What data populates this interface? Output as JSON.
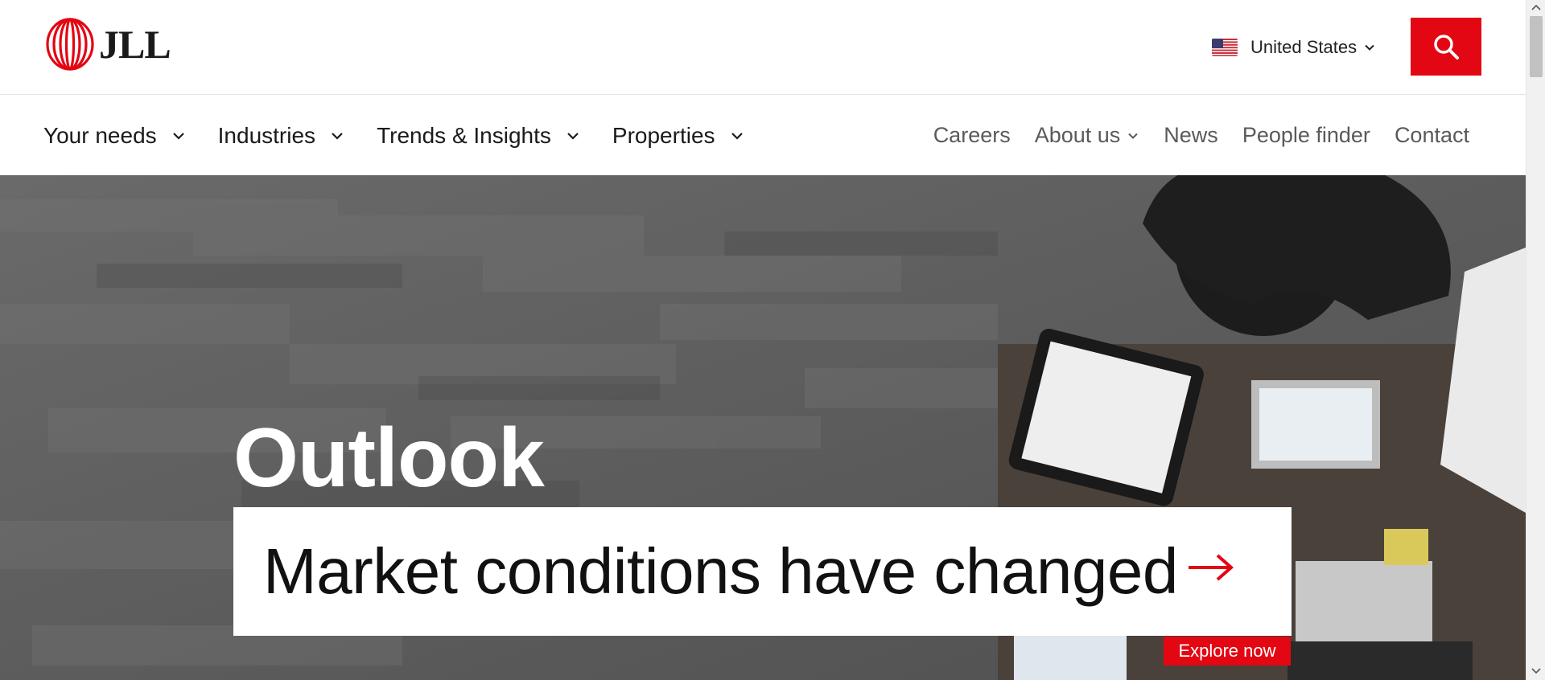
{
  "brand": {
    "logo_text": "JLL",
    "accent_color": "#e30613"
  },
  "header": {
    "country_label": "United States",
    "country_flag_icon": "us-flag-icon",
    "search_icon": "search-icon"
  },
  "nav": {
    "primary": [
      {
        "label": "Your needs"
      },
      {
        "label": "Industries"
      },
      {
        "label": "Trends & Insights"
      },
      {
        "label": "Properties"
      }
    ],
    "utility": [
      {
        "label": "Careers"
      },
      {
        "label": "About us"
      },
      {
        "label": "News"
      },
      {
        "label": "People finder"
      },
      {
        "label": "Contact"
      }
    ]
  },
  "hero": {
    "title": "Outlook",
    "card_text": "Market conditions have changed",
    "cta_label": "Explore now",
    "arrow_icon": "arrow-right-icon"
  }
}
